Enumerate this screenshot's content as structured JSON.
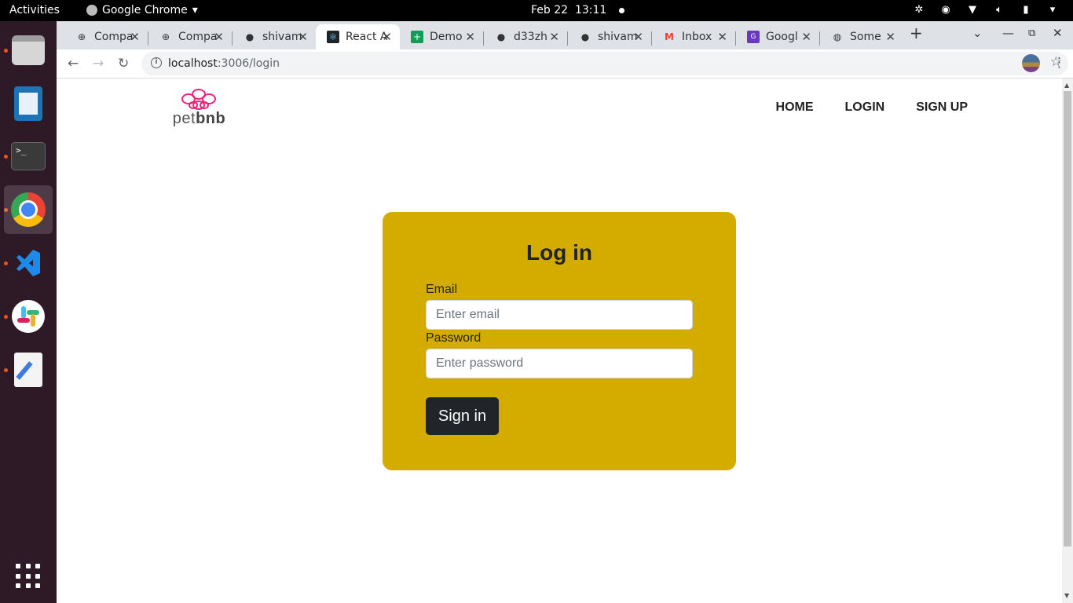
{
  "topbar": {
    "activities": "Activities",
    "app_name": "Google Chrome",
    "date": "Feb 22",
    "time": "13:11"
  },
  "dock": {
    "items": [
      "files",
      "libreoffice-writer",
      "terminal",
      "google-chrome",
      "vscode",
      "slack",
      "text-editor",
      "show-applications"
    ]
  },
  "browser": {
    "tabs": [
      {
        "label": "Compa",
        "icon": "globe-icon"
      },
      {
        "label": "Compa",
        "icon": "globe-icon"
      },
      {
        "label": "shivam",
        "icon": "github-icon"
      },
      {
        "label": "React A",
        "icon": "react-icon",
        "active": true
      },
      {
        "label": "Demo",
        "icon": "sheets-icon"
      },
      {
        "label": "d33zh",
        "icon": "github-icon"
      },
      {
        "label": "shivam",
        "icon": "github-icon"
      },
      {
        "label": "Inbox",
        "icon": "gmail-icon"
      },
      {
        "label": "Googl",
        "icon": "google-forms-icon"
      },
      {
        "label": "Some",
        "icon": "globe-icon"
      }
    ],
    "url_host": "localhost",
    "url_path": ":3006/login"
  },
  "site": {
    "logo_text_light": "pet",
    "logo_text_bold": "bnb",
    "nav": {
      "home": "HOME",
      "login": "LOGIN",
      "signup": "SIGN UP"
    }
  },
  "login": {
    "title": "Log in",
    "email_label": "Email",
    "email_placeholder": "Enter email",
    "email_value": "",
    "password_label": "Password",
    "password_placeholder": "Enter password",
    "password_value": "",
    "submit_label": "Sign in"
  },
  "colors": {
    "card_bg": "#d4ac00",
    "button_bg": "#212529",
    "logo_pink": "#e8247a",
    "dock_bg": "#2e1a27"
  }
}
